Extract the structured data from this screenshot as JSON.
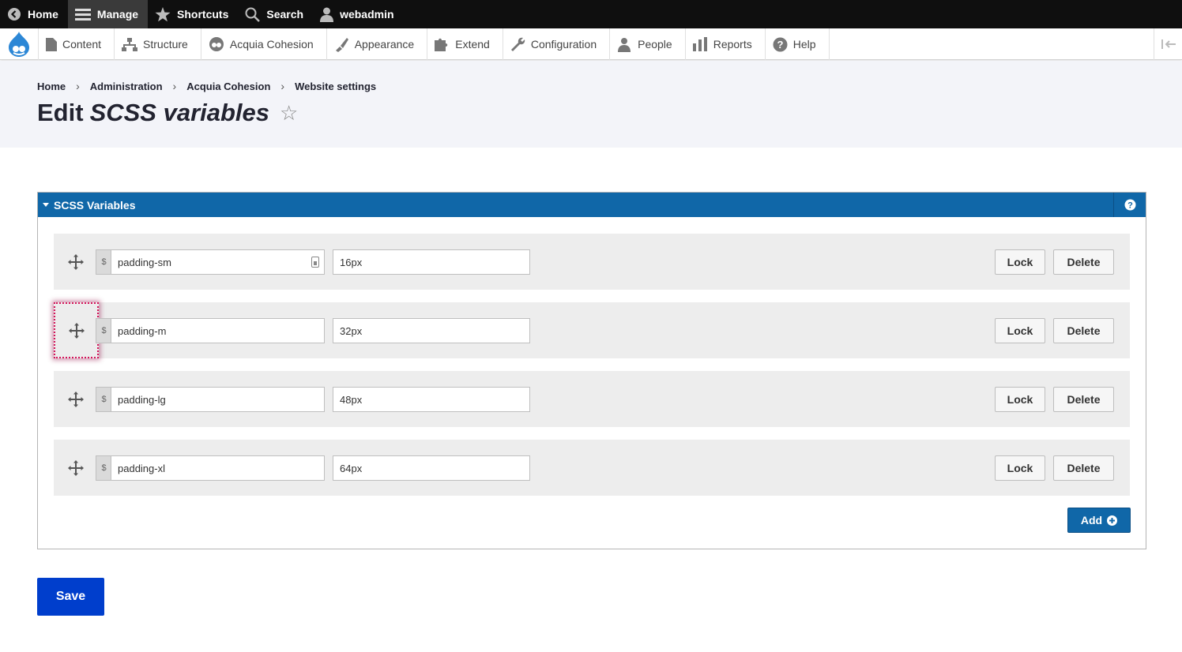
{
  "toolbar": {
    "home": "Home",
    "manage": "Manage",
    "shortcuts": "Shortcuts",
    "search": "Search",
    "user": "webadmin"
  },
  "tray": {
    "items": [
      {
        "label": "Content",
        "icon": "file-icon"
      },
      {
        "label": "Structure",
        "icon": "sitemap-icon"
      },
      {
        "label": "Acquia Cohesion",
        "icon": "cohesion-icon"
      },
      {
        "label": "Appearance",
        "icon": "brush-icon"
      },
      {
        "label": "Extend",
        "icon": "puzzle-icon"
      },
      {
        "label": "Configuration",
        "icon": "wrench-icon"
      },
      {
        "label": "People",
        "icon": "people-icon"
      },
      {
        "label": "Reports",
        "icon": "bar-chart-icon"
      },
      {
        "label": "Help",
        "icon": "help-icon"
      }
    ]
  },
  "breadcrumb": [
    "Home",
    "Administration",
    "Acquia Cohesion",
    "Website settings"
  ],
  "page": {
    "title_prefix": "Edit",
    "title_emphasis": "SCSS variables",
    "star": "☆"
  },
  "panel": {
    "title": "SCSS Variables",
    "help_icon": "?",
    "prefix": "$",
    "rows": [
      {
        "name": "padding-sm",
        "value": "16px",
        "lock": "Lock",
        "delete": "Delete"
      },
      {
        "name": "padding-m",
        "value": "32px",
        "lock": "Lock",
        "delete": "Delete"
      },
      {
        "name": "padding-lg",
        "value": "48px",
        "lock": "Lock",
        "delete": "Delete"
      },
      {
        "name": "padding-xl",
        "value": "64px",
        "lock": "Lock",
        "delete": "Delete"
      }
    ],
    "add_label": "Add"
  },
  "save_label": "Save",
  "colors": {
    "toolbar": "#0f0f0f",
    "panel_header": "#1067a8",
    "save_button": "#003ecc",
    "focus_outline": "#d4145a"
  }
}
